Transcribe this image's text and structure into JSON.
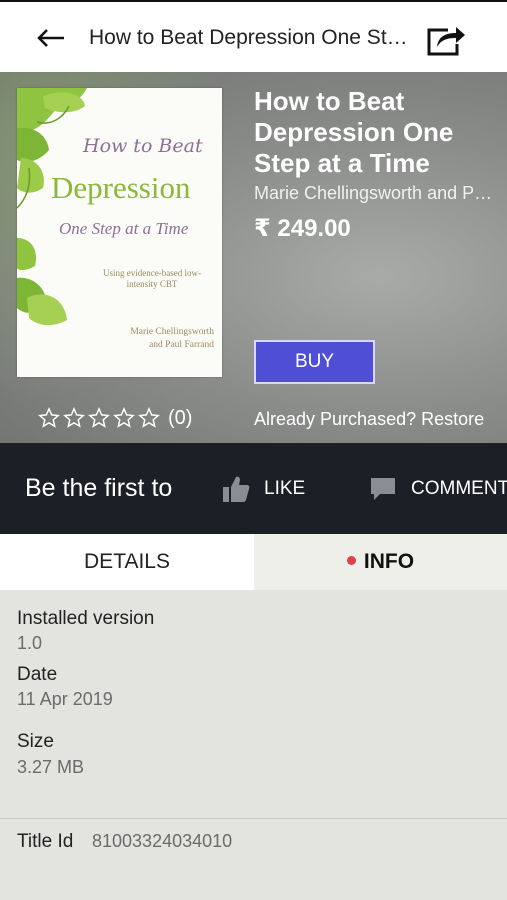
{
  "header": {
    "title": "How to Beat Depression One Step at a Time",
    "back_icon": "arrow-left-icon",
    "share_icon": "share-icon"
  },
  "book": {
    "title": "How to Beat Depression One Step at a Time",
    "author": "Marie Chellingsworth and Paul Farrand",
    "price": "₹ 249.00",
    "cover": {
      "line1": "How to Beat",
      "line2": "Depression",
      "line3": "One Step at a Time",
      "subtitle": "Using evidence-based low-intensity CBT",
      "author_line1": "Marie Chellingsworth",
      "author_line2": "and Paul Farrand"
    }
  },
  "actions": {
    "buy_label": "BUY",
    "rating_count": "(0)",
    "restore_label": "Already Purchased? Restore"
  },
  "rating": {
    "value": 0,
    "max": 5
  },
  "social": {
    "lead_text": "Be the first to",
    "like_label": "LIKE",
    "comment_label": "COMMENT"
  },
  "tabs": {
    "details_label": "DETAILS",
    "info_label": "INFO",
    "active": "INFO"
  },
  "info": {
    "installed_version_label": "Installed version",
    "installed_version_value": "1.0",
    "date_label": "Date",
    "date_value": "11 Apr 2019",
    "size_label": "Size",
    "size_value": "3.27 MB",
    "title_id_label": "Title Id",
    "title_id_value": "81003324034010"
  },
  "colors": {
    "buy_button": "#4f4fd6",
    "social_bar": "#1c1f25",
    "info_dot": "#e0404a",
    "cover_green": "#8ab83a",
    "cover_purple": "#8e6f9a"
  }
}
